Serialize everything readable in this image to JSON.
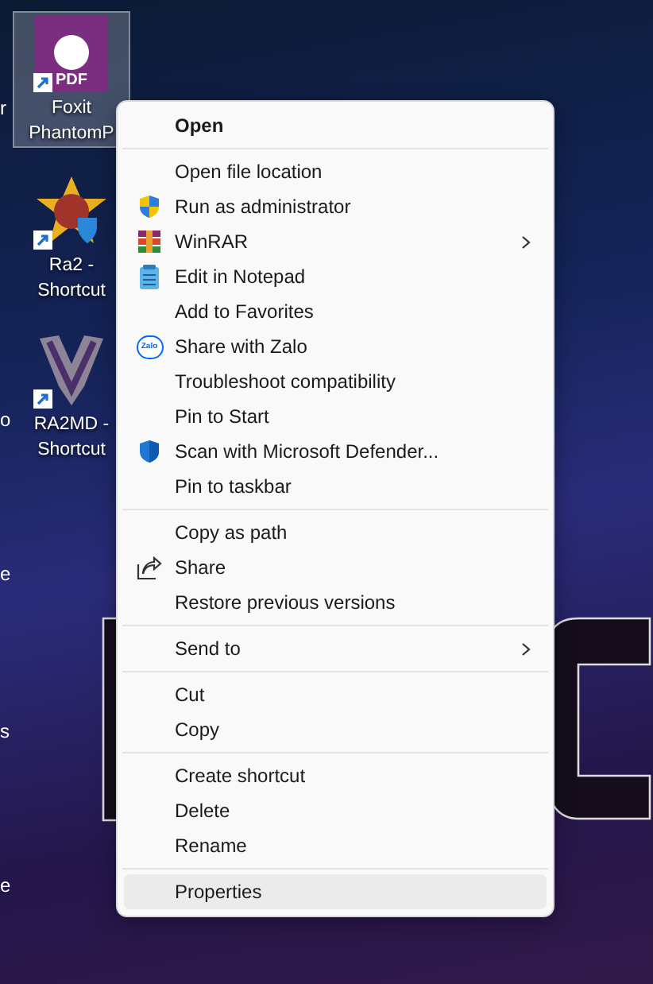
{
  "desktop": {
    "edge_labels": [
      {
        "text": "r"
      },
      {
        "text": "o"
      },
      {
        "text": "e"
      },
      {
        "text": "s"
      },
      {
        "text": "e"
      }
    ],
    "icons": [
      {
        "kind": "pdf",
        "icon_label": "PDF",
        "label_lines": [
          "Foxit",
          "PhantomP"
        ],
        "selected": true
      },
      {
        "kind": "star",
        "label_lines": [
          "Ra2 -",
          "Shortcut"
        ],
        "selected": false
      },
      {
        "kind": "trophy",
        "label_lines": [
          "RA2MD -",
          "Shortcut"
        ],
        "selected": false
      }
    ]
  },
  "context_menu": {
    "groups": [
      [
        {
          "label": "Open",
          "bold": true,
          "selected": false
        }
      ],
      [
        {
          "label": "Open file location",
          "selected": false
        },
        {
          "label": "Run as administrator",
          "kind": "shield",
          "selected": false
        },
        {
          "label": "WinRAR",
          "kind": "archive",
          "submenu": true,
          "selected": false
        },
        {
          "label": "Edit in Notepad",
          "kind": "notepad",
          "selected": false
        },
        {
          "label": "Add to Favorites",
          "selected": false
        },
        {
          "label": "Share with Zalo",
          "kind": "zalo",
          "icon_label": "Zalo",
          "selected": false
        },
        {
          "label": "Troubleshoot compatibility",
          "selected": false
        },
        {
          "label": "Pin to Start",
          "selected": false
        },
        {
          "label": "Scan with Microsoft Defender...",
          "kind": "defender",
          "selected": false
        },
        {
          "label": "Pin to taskbar",
          "selected": false
        }
      ],
      [
        {
          "label": "Copy as path",
          "selected": false
        },
        {
          "label": "Share",
          "kind": "share",
          "selected": false
        },
        {
          "label": "Restore previous versions",
          "selected": false
        }
      ],
      [
        {
          "label": "Send to",
          "submenu": true,
          "selected": false
        }
      ],
      [
        {
          "label": "Cut",
          "selected": false
        },
        {
          "label": "Copy",
          "selected": false
        }
      ],
      [
        {
          "label": "Create shortcut",
          "selected": false
        },
        {
          "label": "Delete",
          "selected": false
        },
        {
          "label": "Rename",
          "selected": false
        }
      ],
      [
        {
          "label": "Properties",
          "selected": true
        }
      ]
    ]
  }
}
